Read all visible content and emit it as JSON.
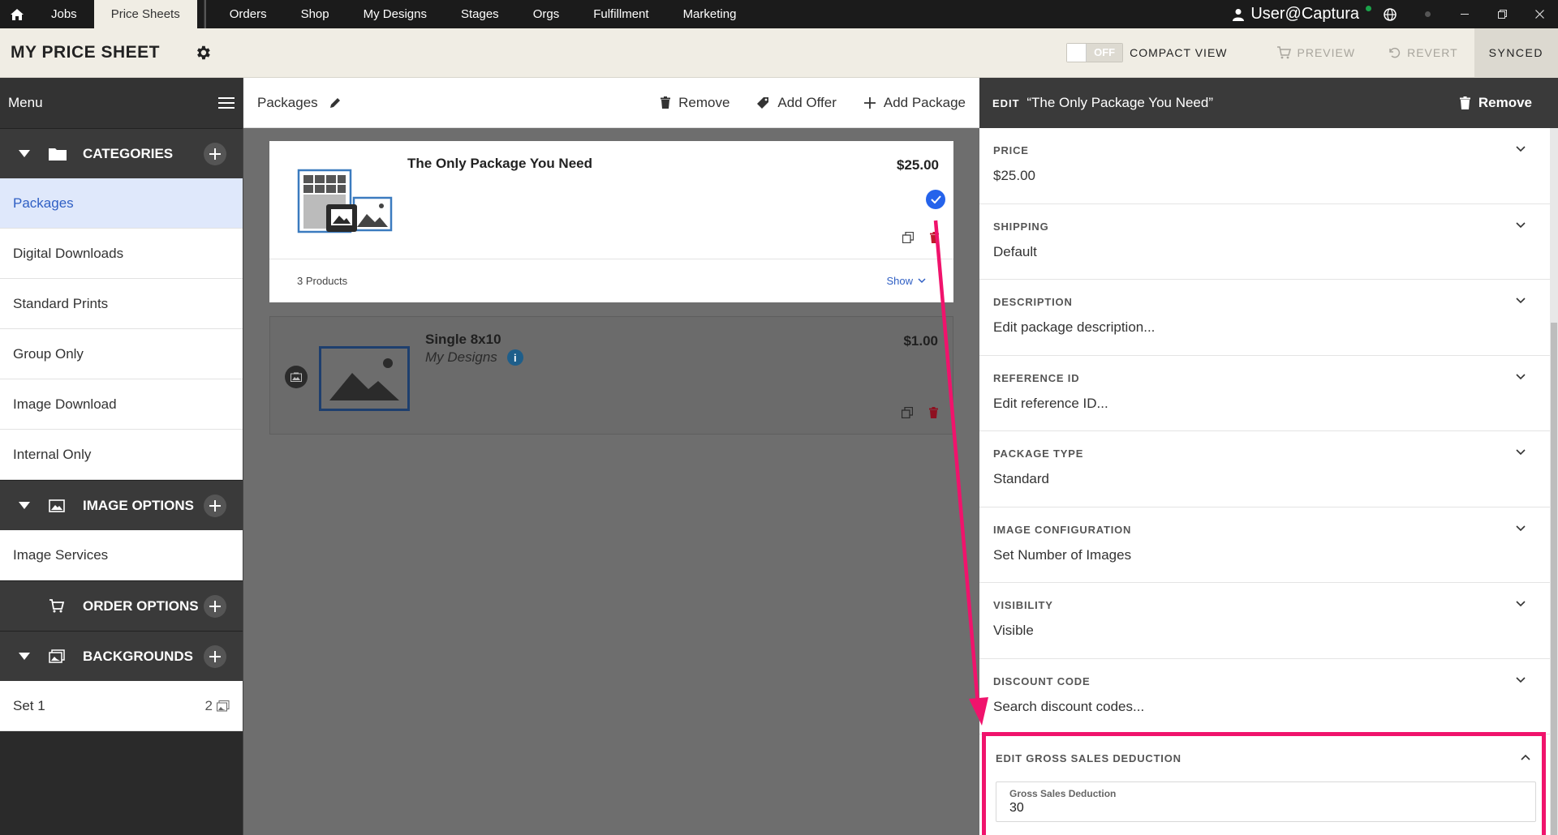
{
  "topnav": {
    "tabs": [
      {
        "label": "Jobs"
      },
      {
        "label": "Price Sheets"
      },
      {
        "label": "Orders"
      },
      {
        "label": "Shop"
      },
      {
        "label": "My Designs"
      },
      {
        "label": "Stages"
      },
      {
        "label": "Orgs"
      },
      {
        "label": "Fulfillment"
      },
      {
        "label": "Marketing"
      }
    ],
    "user": "User@Captura"
  },
  "header": {
    "title": "MY PRICE SHEET",
    "toggle_label": "OFF",
    "compact_view": "COMPACT VIEW",
    "preview": "PREVIEW",
    "revert": "REVERT",
    "synced": "SYNCED"
  },
  "sidebar": {
    "menu_label": "Menu",
    "categories": {
      "title": "CATEGORIES",
      "items": [
        "Packages",
        "Digital Downloads",
        "Standard Prints",
        "Group Only",
        "Image Download",
        "Internal Only"
      ]
    },
    "image_options": {
      "title": "IMAGE OPTIONS",
      "items": [
        "Image Services"
      ]
    },
    "order_options": {
      "title": "ORDER OPTIONS"
    },
    "backgrounds": {
      "title": "BACKGROUNDS",
      "items": [
        {
          "label": "Set 1",
          "count": "2"
        }
      ]
    }
  },
  "middle": {
    "breadcrumb": "Packages",
    "actions": {
      "remove": "Remove",
      "add_offer": "Add Offer",
      "add_package": "Add Package"
    },
    "packages": [
      {
        "title": "The Only Package You Need",
        "price": "$25.00",
        "products": "3 Products",
        "show": "Show"
      },
      {
        "title": "Single 8x10",
        "subtitle": "My Designs",
        "price": "$1.00"
      }
    ]
  },
  "panel": {
    "edit_prefix": "EDIT",
    "edit_name": "“The Only Package You Need”",
    "remove": "Remove",
    "fields": [
      {
        "label": "PRICE",
        "value": "$25.00"
      },
      {
        "label": "SHIPPING",
        "value": "Default"
      },
      {
        "label": "DESCRIPTION",
        "value": "Edit package description..."
      },
      {
        "label": "REFERENCE ID",
        "value": "Edit reference ID..."
      },
      {
        "label": "PACKAGE TYPE",
        "value": "Standard"
      },
      {
        "label": "IMAGE CONFIGURATION",
        "value": "Set Number of Images"
      },
      {
        "label": "VISIBILITY",
        "value": "Visible"
      },
      {
        "label": "DISCOUNT CODE",
        "value": "Search discount codes..."
      }
    ],
    "gsd": {
      "label": "EDIT GROSS SALES DEDUCTION",
      "input_label": "Gross Sales Deduction",
      "input_value": "30"
    }
  },
  "colors": {
    "accent": "#2563eb",
    "highlight": "#f0136c",
    "delete": "#c0192c"
  }
}
